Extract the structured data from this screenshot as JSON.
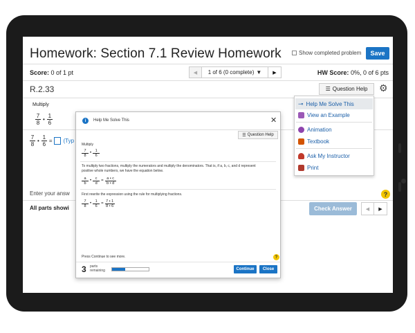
{
  "page": {
    "title": "Homework: Section 7.1 Review Homework",
    "show_completed_label": "Show completed problem",
    "save_label": "Save"
  },
  "score_bar": {
    "score_label": "Score:",
    "score_value": "0 of 1 pt",
    "nav_prev_icon": "chevron-left-icon",
    "nav_selector": "1 of 6 (0 complete)",
    "nav_next_icon": "chevron-right-icon",
    "hw_score_label": "HW Score:",
    "hw_score_value": "0%, 0 of 6 pts"
  },
  "question": {
    "id": "R.2.33",
    "help_button": "Question Help",
    "multiply_label": "Multiply",
    "expr": {
      "n1": "7",
      "d1": "8",
      "op": "•",
      "n2": "1",
      "d2": "6"
    },
    "answer_expr": {
      "n1": "7",
      "d1": "8",
      "op": "•",
      "n2": "1",
      "d2": "6",
      "eq": "=",
      "hint": "(Typ"
    },
    "enter_answer": "Enter your answ",
    "help_icon": "?",
    "all_parts": "All parts showi",
    "check_answer": "Check Answer"
  },
  "help_menu": {
    "items": [
      {
        "label": "Help Me Solve This",
        "icon": "key-icon"
      },
      {
        "label": "View an Example",
        "icon": "example-icon"
      },
      {
        "label": "Animation",
        "icon": "animation-icon"
      },
      {
        "label": "Textbook",
        "icon": "book-icon"
      },
      {
        "label": "Ask My Instructor",
        "icon": "instructor-icon"
      },
      {
        "label": "Print",
        "icon": "print-icon"
      }
    ]
  },
  "modal": {
    "title": "Help Me Solve This",
    "close_glyph": "✕",
    "help_button": "Question Help",
    "multiply_label": "Multiply",
    "step1": "To multiply two fractions, multiply the numerators and multiply the denominators. That is, if a, b, c, and d represent positive whole numbers, we have the equation below.",
    "rule": {
      "a": "a",
      "b": "b",
      "c": "c",
      "d": "d",
      "rn": "a • c",
      "rd": "b • d"
    },
    "step2": "First rewrite the expression using the rule for multiplying fractions.",
    "rewrite": {
      "rn": "7 • 1",
      "rd": "8 • 6"
    },
    "press_continue": "Press Continue to see more.",
    "parts_count": "3",
    "parts_label": "parts remaining",
    "progress": 0.35,
    "continue_label": "Continue",
    "close_label": "Close"
  },
  "colors": {
    "accent": "#1b74c5",
    "device": "#1b1b1b"
  }
}
